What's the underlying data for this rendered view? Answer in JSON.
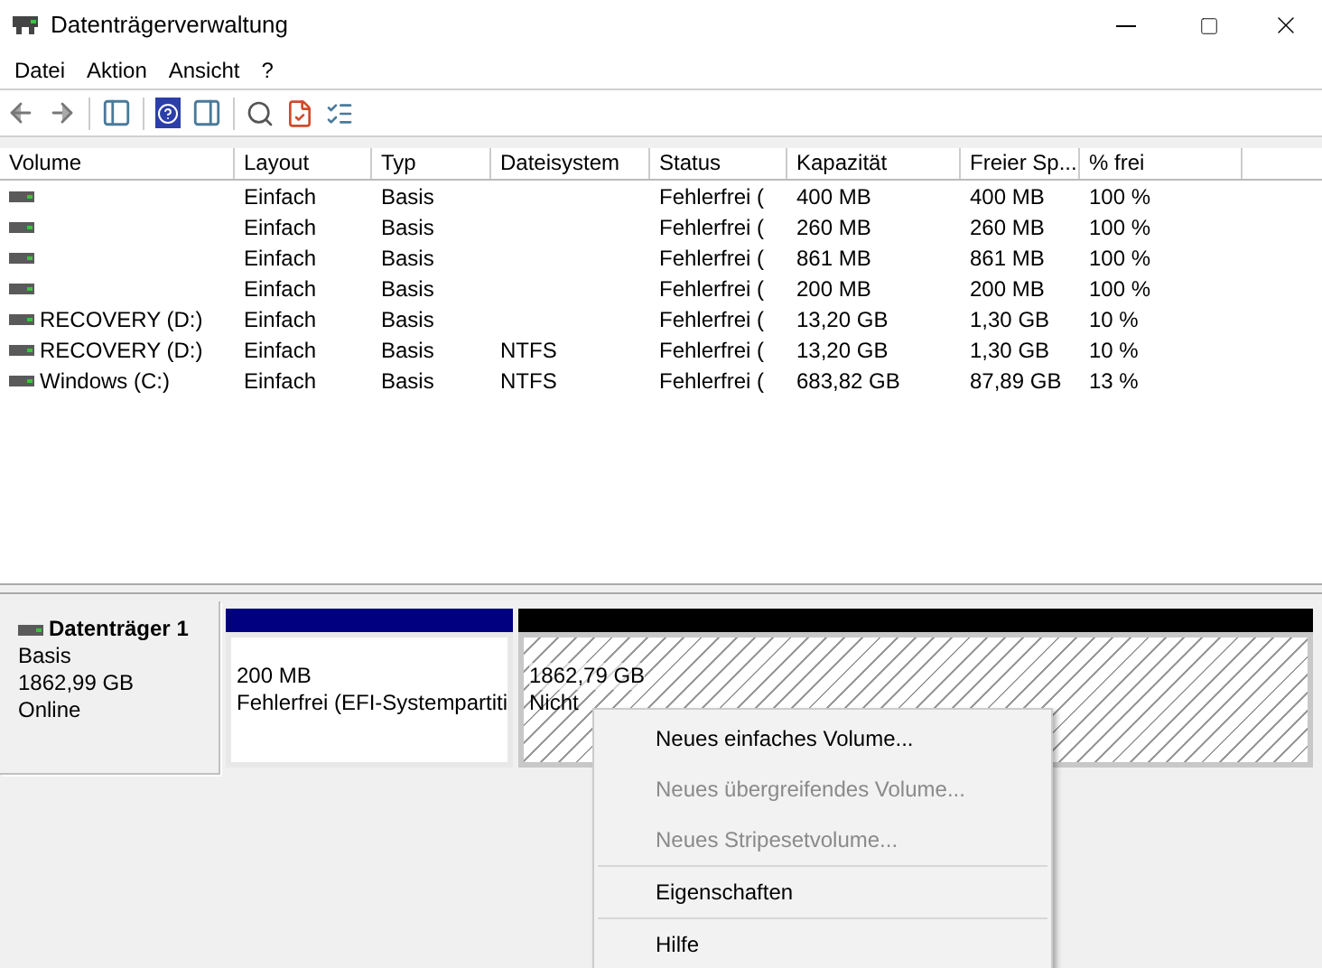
{
  "window": {
    "title": "Datenträgerverwaltung"
  },
  "menu_bar": [
    "Datei",
    "Aktion",
    "Ansicht",
    "?"
  ],
  "table": {
    "columns": [
      "Volume",
      "Layout",
      "Typ",
      "Dateisystem",
      "Status",
      "Kapazität",
      "Freier Sp...",
      "% frei"
    ],
    "rows": [
      {
        "layout": "Einfach",
        "type": "Basis",
        "status": "Fehlerfrei (",
        "capacity": "400 MB",
        "free": "400 MB",
        "percent_free": "100 %"
      },
      {
        "layout": "Einfach",
        "type": "Basis",
        "status": "Fehlerfrei (",
        "capacity": "260 MB",
        "free": "260 MB",
        "percent_free": "100 %"
      },
      {
        "layout": "Einfach",
        "type": "Basis",
        "status": "Fehlerfrei (",
        "capacity": "861 MB",
        "free": "861 MB",
        "percent_free": "100 %"
      },
      {
        "layout": "Einfach",
        "type": "Basis",
        "status": "Fehlerfrei (",
        "capacity": "200 MB",
        "free": "200 MB",
        "percent_free": "100 %"
      },
      {
        "volume": "RECOVERY (D:)",
        "layout": "Einfach",
        "type": "Basis",
        "status": "Fehlerfrei (",
        "capacity": "13,20 GB",
        "free": "1,30 GB",
        "percent_free": "10 %"
      },
      {
        "volume": "RECOVERY (D:)",
        "layout": "Einfach",
        "type": "Basis",
        "filesystem": "NTFS",
        "status": "Fehlerfrei (",
        "capacity": "13,20 GB",
        "free": "1,30 GB",
        "percent_free": "10 %"
      },
      {
        "volume": "Windows (C:)",
        "layout": "Einfach",
        "type": "Basis",
        "filesystem": "NTFS",
        "status": "Fehlerfrei (",
        "capacity": "683,82 GB",
        "free": "87,89 GB",
        "percent_free": "13 %"
      }
    ]
  },
  "disk": {
    "name": "Datenträger 1",
    "type": "Basis",
    "size": "1862,99 GB",
    "state": "Online",
    "partitions": [
      {
        "kind": "primary",
        "size": "200 MB",
        "label": "Fehlerfrei (EFI-Systempartiti"
      },
      {
        "kind": "unallocated",
        "size": "1862,79 GB",
        "label": "Nicht"
      }
    ]
  },
  "context_menu": {
    "groups": [
      [
        {
          "label": "Neues einfaches Volume...",
          "disabled": false
        },
        {
          "label": "Neues übergreifendes Volume...",
          "disabled": true
        },
        {
          "label": "Neues Stripesetvolume...",
          "disabled": true
        }
      ],
      [
        {
          "label": "Eigenschaften",
          "disabled": false
        }
      ],
      [
        {
          "label": "Hilfe",
          "disabled": false
        }
      ]
    ]
  }
}
